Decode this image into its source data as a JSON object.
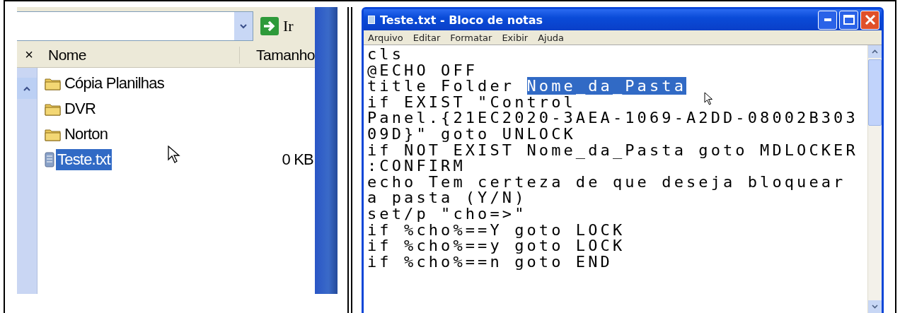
{
  "explorer": {
    "go_button": "Ir",
    "close_glyph": "×",
    "columns": [
      "Nome",
      "Tamanho"
    ],
    "files": [
      {
        "name": "Cópia Planilhas",
        "kind": "folder",
        "selected": false
      },
      {
        "name": "DVR",
        "kind": "folder",
        "selected": false
      },
      {
        "name": "Norton",
        "kind": "folder",
        "selected": false
      },
      {
        "name": "Teste.txt",
        "kind": "text",
        "selected": true,
        "size": "0 KB"
      }
    ]
  },
  "notepad": {
    "title": "Teste.txt - Bloco de notas",
    "menu": [
      "Arquivo",
      "Editar",
      "Formatar",
      "Exibir",
      "Ajuda"
    ],
    "lines": [
      [
        {
          "text": "cls",
          "selected": false
        }
      ],
      [
        {
          "text": "@ECHO OFF",
          "selected": false
        }
      ],
      [
        {
          "text": "title Folder ",
          "selected": false
        },
        {
          "text": "Nome_da_Pasta",
          "selected": true
        }
      ],
      [
        {
          "text": "if EXIST \"Control",
          "selected": false
        }
      ],
      [
        {
          "text": "Panel.{21EC2020-3AEA-1069-A2DD-08002B303",
          "selected": false
        }
      ],
      [
        {
          "text": "09D}\" goto UNLOCK",
          "selected": false
        }
      ],
      [
        {
          "text": "if NOT EXIST Nome_da_Pasta goto MDLOCKER",
          "selected": false
        }
      ],
      [
        {
          "text": ":CONFIRM",
          "selected": false
        }
      ],
      [
        {
          "text": "echo Tem certeza de que deseja bloquear",
          "selected": false
        }
      ],
      [
        {
          "text": "a pasta (Y/N)",
          "selected": false
        }
      ],
      [
        {
          "text": "set/p \"cho=>\"",
          "selected": false
        }
      ],
      [
        {
          "text": "if %cho%==Y goto LOCK",
          "selected": false
        }
      ],
      [
        {
          "text": "if %cho%==y goto LOCK",
          "selected": false
        }
      ],
      [
        {
          "text": "if %cho%==n goto END",
          "selected": false
        }
      ]
    ]
  }
}
